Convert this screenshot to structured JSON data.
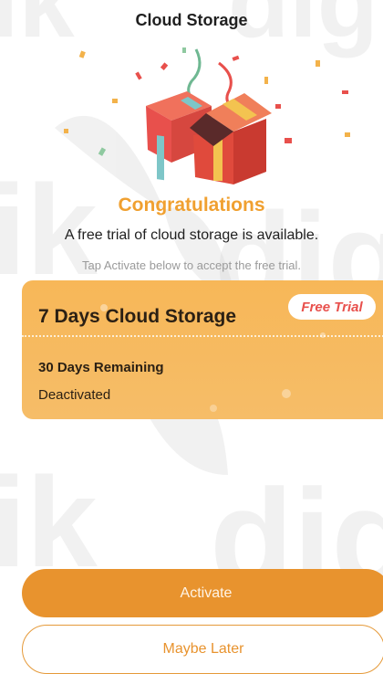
{
  "header": {
    "title": "Cloud Storage"
  },
  "hero": {
    "heading": "Congratulations",
    "subtitle": "A free trial of cloud storage is available.",
    "hint": "Tap Activate below to accept the free trial."
  },
  "plan_card": {
    "title": "7 Days Cloud Storage",
    "badge": "Free Trial",
    "remaining": "30 Days Remaining",
    "status": "Deactivated"
  },
  "actions": {
    "activate_label": "Activate",
    "later_label": "Maybe Later"
  },
  "colors": {
    "accent": "#e8932e",
    "card": "#f7b758",
    "badge_text": "#e8504c",
    "heading": "#f0a030"
  },
  "watermark": {
    "text": "dig",
    "icon": "butterfly-icon"
  }
}
